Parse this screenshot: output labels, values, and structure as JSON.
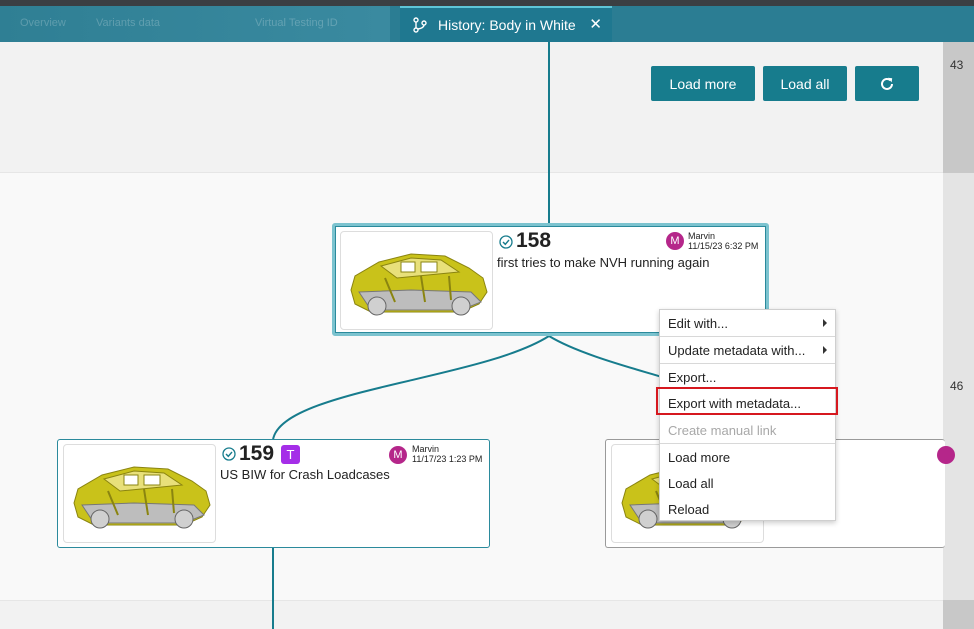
{
  "tabs": {
    "ghost": [
      "Overview",
      "Variants data",
      "Virtual Testing ID"
    ],
    "active_label": "History: Body in White",
    "close_glyph": "✕"
  },
  "toolbar": {
    "load_more": "Load more",
    "load_all": "Load all",
    "reload_icon": "refresh-icon"
  },
  "gutter": {
    "row_a": "43",
    "row_b": "46"
  },
  "nodes": {
    "n158": {
      "number": "158",
      "description": "first tries to make NVH running again",
      "user_initial": "M",
      "user": "Marvin",
      "date": "11/15/23 6:32 PM"
    },
    "n159": {
      "number": "159",
      "tag": "T",
      "description": "US BIW for Crash Loadcases",
      "user_initial": "M",
      "user": "Marvin",
      "date": "11/17/23 1:23 PM"
    }
  },
  "context_menu": {
    "items": [
      {
        "label": "Edit with...",
        "submenu": true,
        "enabled": true
      },
      {
        "label": "Update metadata with...",
        "submenu": true,
        "enabled": true
      },
      {
        "label": "Export...",
        "submenu": false,
        "enabled": true
      },
      {
        "label": "Export with metadata...",
        "submenu": false,
        "enabled": true,
        "highlighted": true
      },
      {
        "label": "Create manual link",
        "submenu": false,
        "enabled": false
      },
      {
        "label": "Load more",
        "submenu": false,
        "enabled": true
      },
      {
        "label": "Load all",
        "submenu": false,
        "enabled": true
      },
      {
        "label": "Reload",
        "submenu": false,
        "enabled": true
      }
    ]
  },
  "colors": {
    "accent": "#177c8d",
    "tag": "#a52ee8",
    "avatar": "#b5268a",
    "highlight": "#d6181f"
  }
}
